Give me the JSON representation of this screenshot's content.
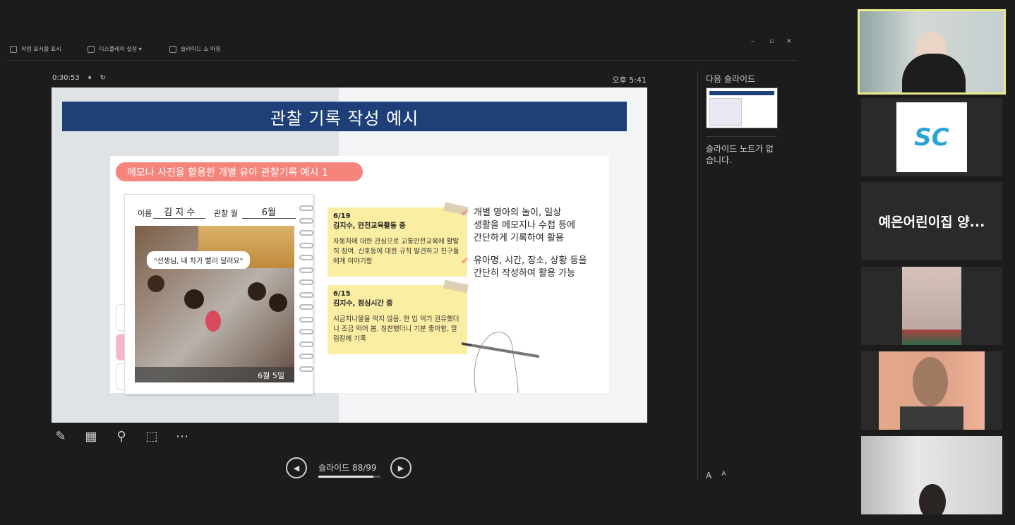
{
  "toolbar": {
    "items": [
      {
        "label": "작업 표시줄 표시",
        "icon": "taskbar-icon"
      },
      {
        "label": "디스플레이 설정 ▾",
        "icon": "display-icon"
      },
      {
        "label": "슬라이드 쇼 마침",
        "icon": "end-show-icon"
      }
    ],
    "window_controls": [
      "–",
      "▫",
      "✕"
    ]
  },
  "presenter": {
    "elapsed": "0:30:53",
    "pause_glyph": "⏸",
    "reset_glyph": "↻",
    "clock": "오후 5:41"
  },
  "slide": {
    "title": "관찰 기록 작성 예시",
    "pill": "메모나 사진을 활용한 개별 유아 관찰기록 예시 1",
    "name_label": "이름",
    "name_value": "김 지 수",
    "month_label": "관찰 월",
    "month_value": "6월",
    "photo_quote": "\"선생님, 내 차가 빨리 달려요\"",
    "photo_caption": "6월 5일",
    "note1": {
      "date": "6/19",
      "heading": "김지수, 안전교육활동 중",
      "body": "자동차에 대한 관심으로 교통안전교육에 활발히 참여. 신호등에 대한 규칙 발견하고 친구들에게 이야기함"
    },
    "note2": {
      "date": "6/15",
      "heading": "김지수, 점심시간 중",
      "body": "시금치나물을 먹지 않음. 한 입 먹기 권유했더니 조금 먹어 봄. 칭찬했더니 기분 좋아함, 알림장에 기록"
    },
    "check1": [
      "개별 영아의 놀이, 일상",
      "생활을 메모지나 수첩 등에",
      "간단하게 기록하여 활용"
    ],
    "check2": [
      "유아명, 시간, 장소, 상황 등을",
      "간단히 작성하여 활용 가능"
    ],
    "check_glyph": "✔"
  },
  "controls": {
    "tools": [
      {
        "name": "pen-icon",
        "glyph": "✎"
      },
      {
        "name": "all-slides-icon",
        "glyph": "▦"
      },
      {
        "name": "zoom-icon",
        "glyph": "⚲"
      },
      {
        "name": "pointer-options-icon",
        "glyph": "⬚"
      },
      {
        "name": "more-options-icon",
        "glyph": "⋯"
      }
    ],
    "prev_glyph": "◀",
    "next_glyph": "▶",
    "slide_counter": "슬라이드 88/99",
    "progress": 0.889
  },
  "side_panel": {
    "next_label": "다음 슬라이드",
    "notes_text": "슬라이드 노트가 없습니다.",
    "font_up": "A",
    "font_down": "A"
  },
  "participants": [
    {
      "type": "video",
      "tone": "#b9c3c2"
    },
    {
      "type": "logo",
      "logo_text": "SC"
    },
    {
      "type": "name",
      "name": "예은어린이집 양..."
    },
    {
      "type": "video",
      "tone": "#c9b6ae"
    },
    {
      "type": "video",
      "tone": "#d9a88c"
    },
    {
      "type": "video",
      "tone": "#cfcfcf"
    }
  ],
  "colors": {
    "title_bar": "#1f3f78",
    "pill": "#f4847c",
    "note": "#fbeda2",
    "active_speaker": "#e7e98a"
  }
}
